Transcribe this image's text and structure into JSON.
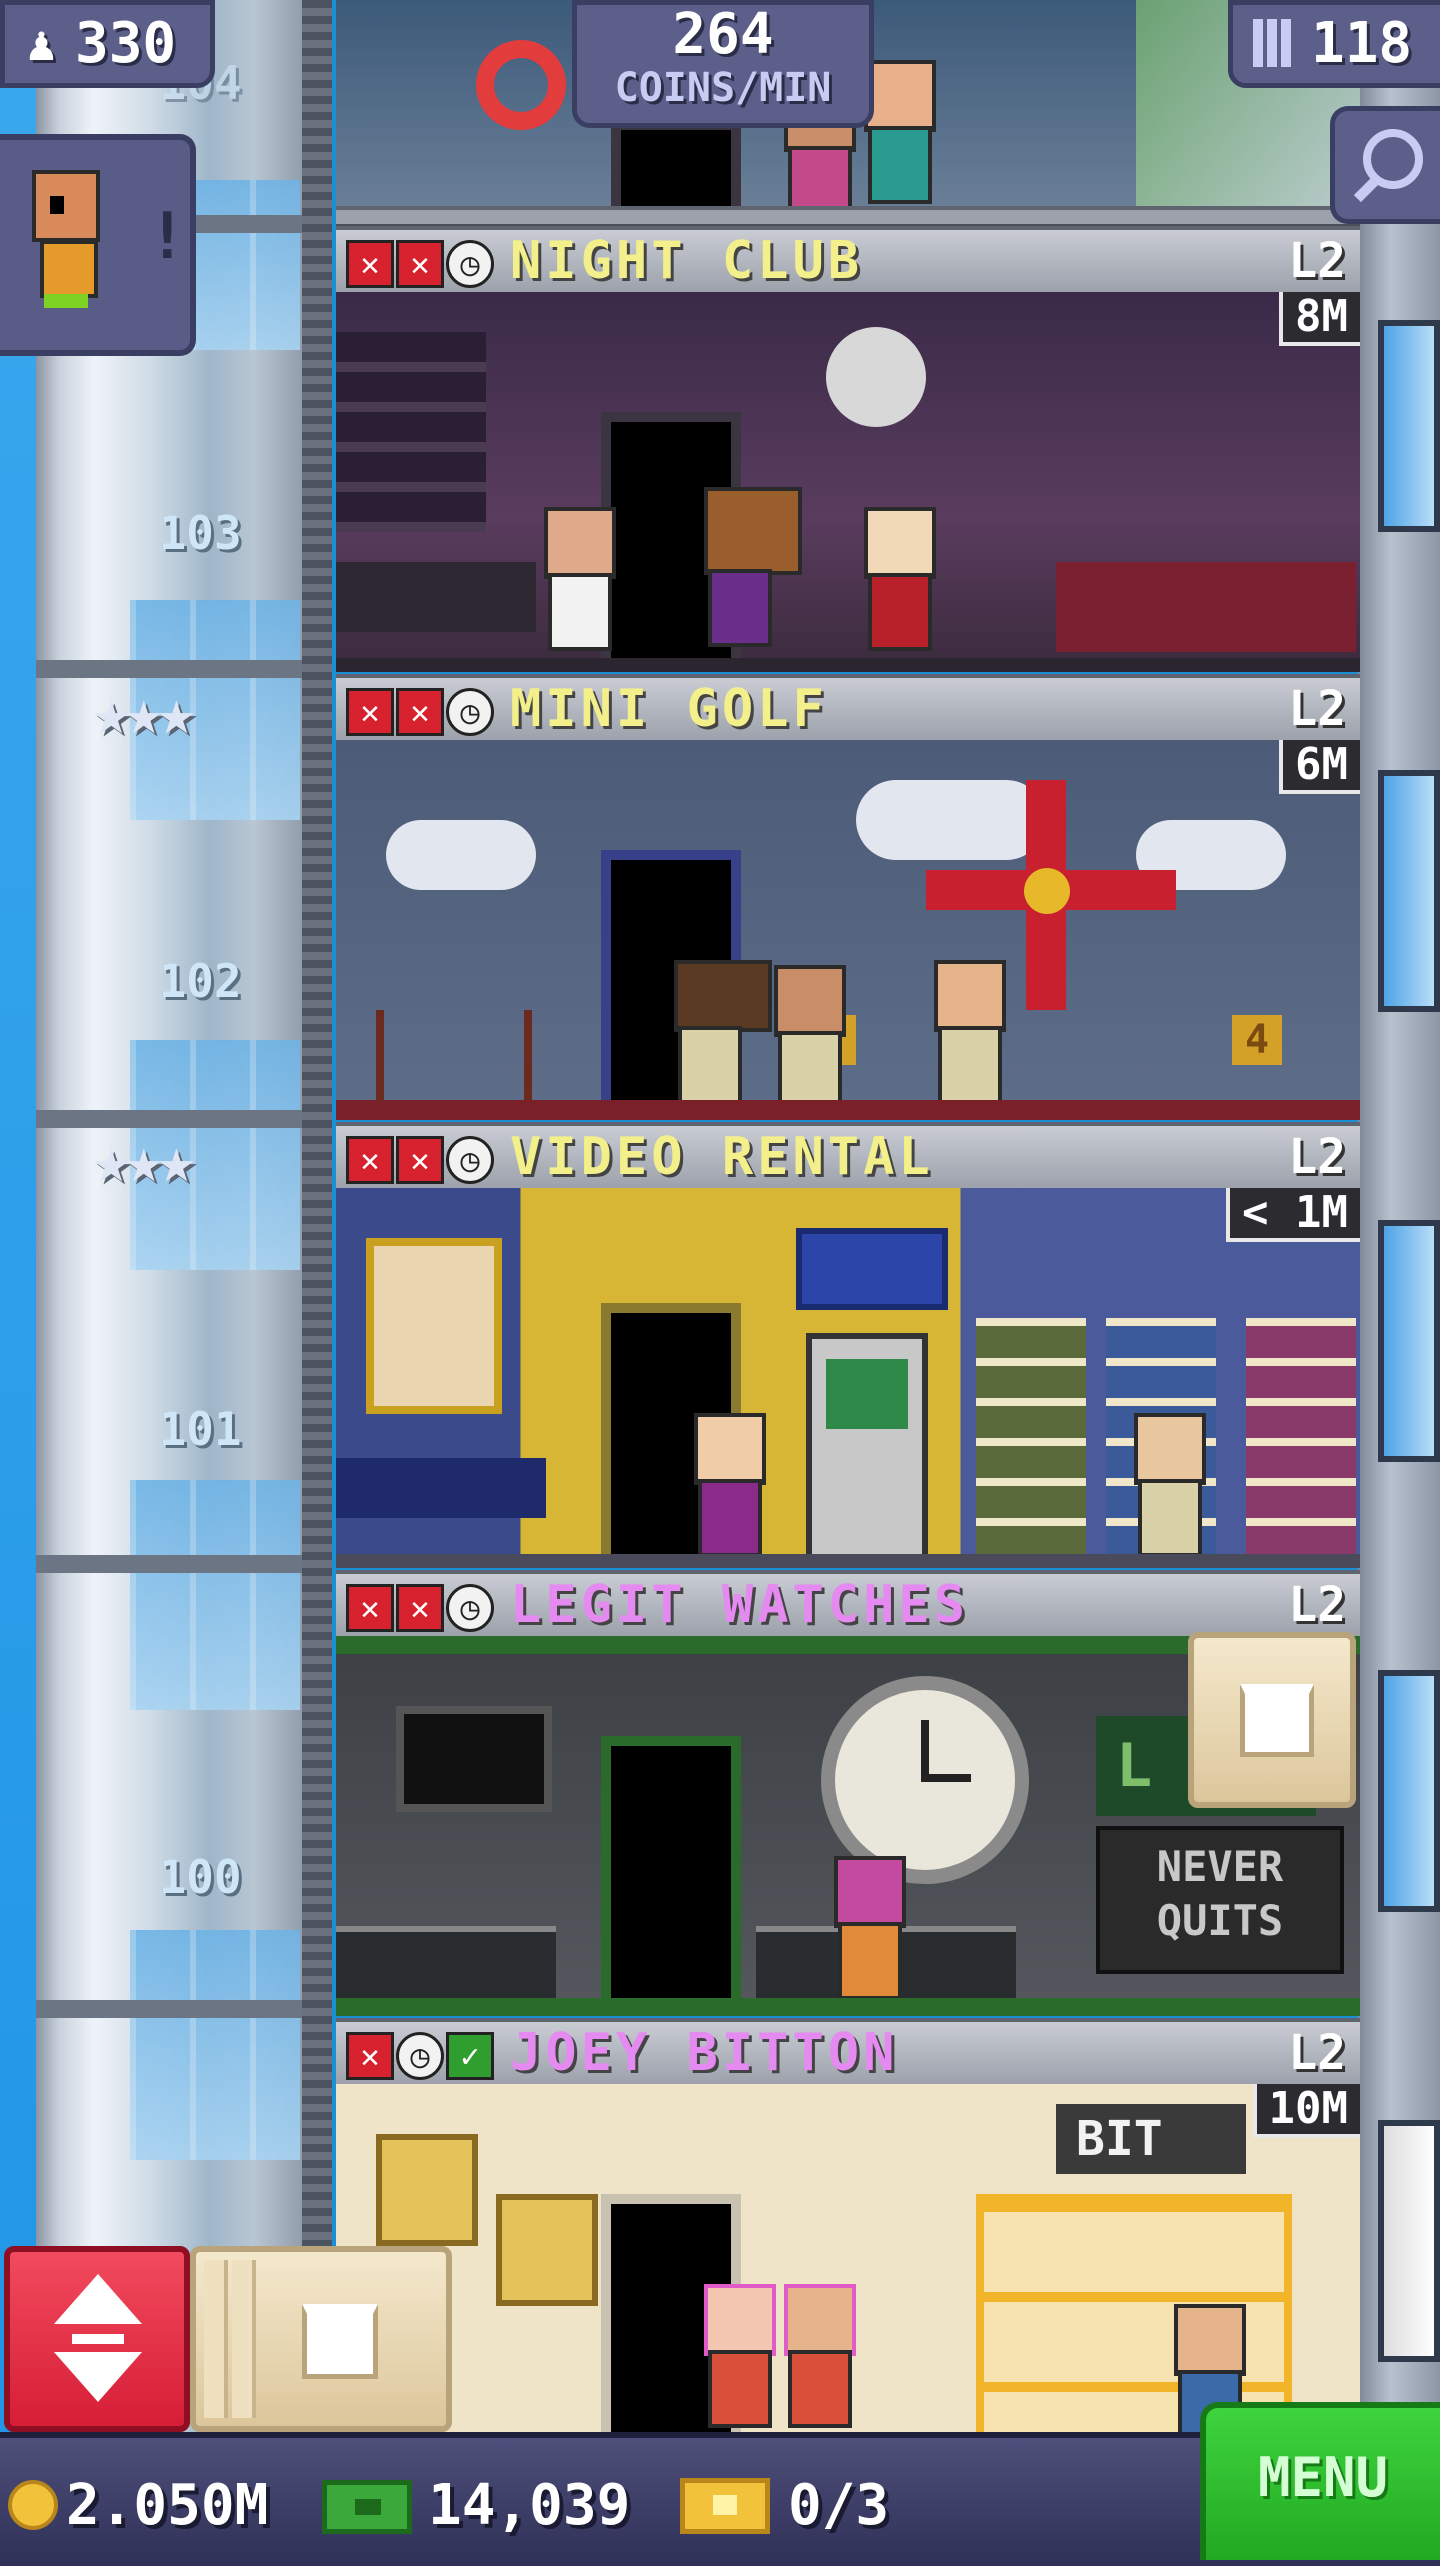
{
  "top_bar": {
    "population": "330",
    "coins_rate_value": "264",
    "coins_rate_unit": "COINS/MIN",
    "floors": "118",
    "partial_floor_number": "104"
  },
  "shaft_labels": [
    "103",
    "102",
    "101",
    "100"
  ],
  "floors": [
    {
      "name": "NIGHT CLUB",
      "level": "L2",
      "timer": "8M",
      "name_color": "#f3ef8a",
      "status_icons": [
        "x",
        "x",
        "clock"
      ]
    },
    {
      "name": "MINI GOLF",
      "level": "L2",
      "timer": "6M",
      "name_color": "#f3ef8a",
      "status_icons": [
        "x",
        "x",
        "clock"
      ],
      "sign_left": "3",
      "sign_right": "4"
    },
    {
      "name": "VIDEO RENTAL",
      "level": "L2",
      "timer": "< 1M",
      "name_color": "#f3ef8a",
      "status_icons": [
        "x",
        "x",
        "clock"
      ]
    },
    {
      "name": "LEGIT WATCHES",
      "level": "L2",
      "timer": "",
      "name_color": "#e58af0",
      "status_icons": [
        "x",
        "x",
        "clock"
      ],
      "sign_line1": "NEVER",
      "sign_line2": "QUITS",
      "sign_small": "L"
    },
    {
      "name": "JOEY BITTON",
      "level": "L2",
      "timer": "10M",
      "name_color": "#e58af0",
      "status_icons": [
        "x",
        "clock",
        "check"
      ],
      "sign": "BIT"
    }
  ],
  "bottom_bar": {
    "coins": "2.050M",
    "bux": "14,039",
    "tickets": "0/3",
    "menu_label": "MENU"
  },
  "colors": {
    "sky": "#2196e6",
    "elevator_button": "#e8293f",
    "menu_button": "#2fbf2f",
    "cream_button": "#ecdcb7",
    "status_red": "#d8212f"
  },
  "icons": {
    "population": "person-icon",
    "floors": "building-icon",
    "search": "magnifier-icon",
    "elevator": "up-down-arrows-icon",
    "build": "bucket-icon",
    "coin": "coin-icon",
    "bux": "money-icon",
    "ticket": "golden-ticket-icon",
    "vip_stars": "star-icon"
  }
}
